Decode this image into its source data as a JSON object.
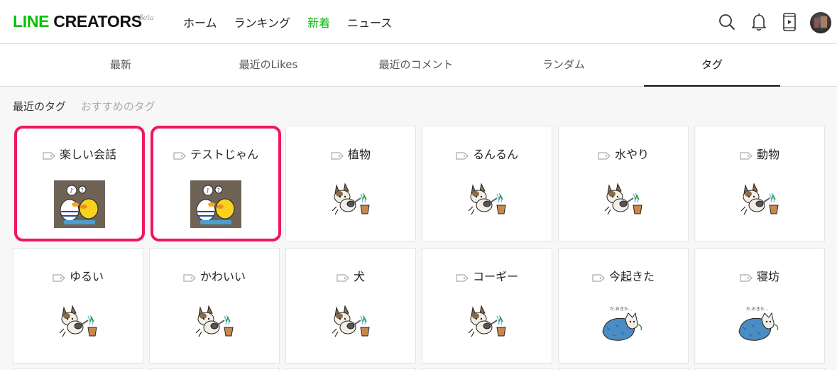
{
  "header": {
    "logo_main": "LINE CREATORS",
    "logo_beta": "βeta",
    "nav": [
      "ホーム",
      "ランキング",
      "新着",
      "ニュース"
    ],
    "nav_active": "新着",
    "icons": [
      "search-icon",
      "bell-icon",
      "phone-icon",
      "avatar"
    ]
  },
  "tabs": [
    "最新",
    "最近のLikes",
    "最近のコメント",
    "ランダム",
    "タグ"
  ],
  "active_tab": "タグ",
  "subtabs": {
    "recent": "最近のタグ",
    "recommended": "おすすめのタグ"
  },
  "highlight_color": "#f0175e",
  "brand_green": "#00b900",
  "cards": [
    {
      "label": "楽しい会話",
      "image": "duck-chat-sticker"
    },
    {
      "label": "テストじゃん",
      "image": "duck-chat-sticker"
    },
    {
      "label": "植物",
      "image": "dog-watering-sticker"
    },
    {
      "label": "るんるん",
      "image": "dog-watering-sticker"
    },
    {
      "label": "水やり",
      "image": "dog-watering-sticker"
    },
    {
      "label": "動物",
      "image": "dog-watering-sticker"
    },
    {
      "label": "ゆるい",
      "image": "dog-watering-sticker"
    },
    {
      "label": "かわいい",
      "image": "dog-watering-sticker"
    },
    {
      "label": "犬",
      "image": "dog-watering-sticker"
    },
    {
      "label": "コーギー",
      "image": "dog-watering-sticker"
    },
    {
      "label": "今起きた",
      "image": "sleeping-bag-sticker"
    },
    {
      "label": "寝坊",
      "image": "sleeping-bag-sticker"
    }
  ]
}
